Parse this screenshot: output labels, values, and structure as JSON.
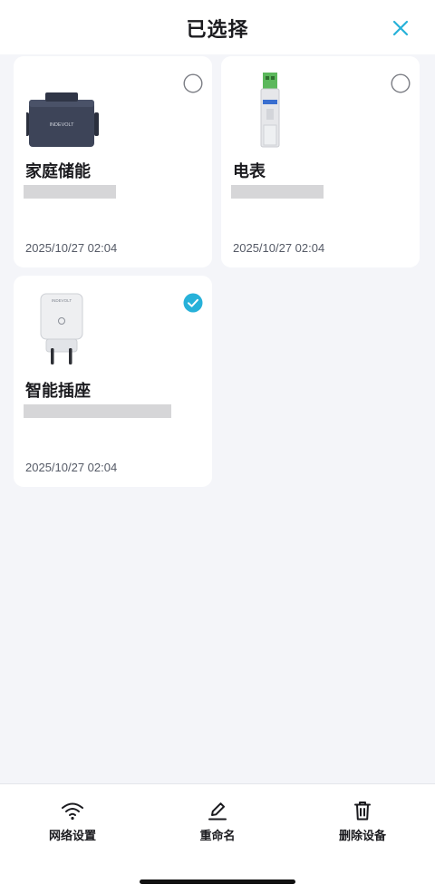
{
  "header": {
    "title": "已选择",
    "close_icon": "close-icon"
  },
  "devices": [
    {
      "name": "家庭储能",
      "time": "2025/10/27 02:04",
      "selected": false,
      "image": "battery-storage-image",
      "blur_width": 102
    },
    {
      "name": "电表",
      "time": "2025/10/27 02:04",
      "selected": false,
      "image": "energy-meter-image",
      "blur_width": 102
    },
    {
      "name": "智能插座",
      "time": "2025/10/27 02:04",
      "selected": true,
      "image": "smart-plug-image",
      "blur_width": 163
    }
  ],
  "actions": [
    {
      "label": "网络设置",
      "icon": "wifi-icon"
    },
    {
      "label": "重命名",
      "icon": "pencil-icon"
    },
    {
      "label": "删除设备",
      "icon": "trash-icon"
    }
  ],
  "colors": {
    "accent": "#27b1d9",
    "background": "#f4f5f9",
    "card": "#ffffff",
    "placeholder": "#d6d6d8"
  }
}
